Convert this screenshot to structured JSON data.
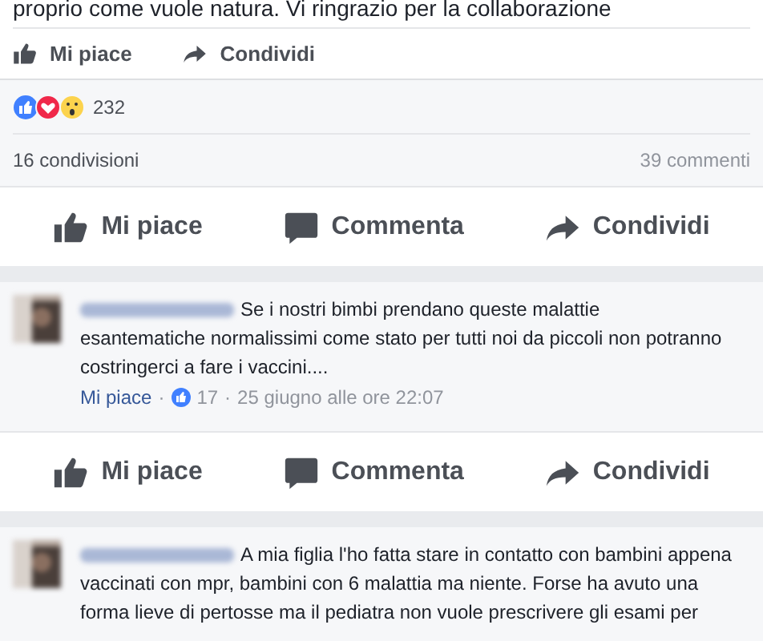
{
  "post": {
    "text_tail": "proprio come vuole natura. Vi ringrazio per la collaborazione",
    "actions": [
      {
        "kind": "like",
        "label": "Mi piace"
      },
      {
        "kind": "share",
        "label": "Condividi"
      }
    ],
    "reactions_count": "232",
    "shares": "16 condivisioni",
    "comments_count": "39 commenti"
  },
  "blocks": [
    {
      "kind": "actionbar",
      "actions": [
        {
          "kind": "like",
          "label": "Mi piace"
        },
        {
          "kind": "comment",
          "label": "Commenta"
        },
        {
          "kind": "share",
          "label": "Condividi"
        }
      ]
    },
    {
      "kind": "comment",
      "lines": [
        "Se i nostri bimbi prendano queste malattie",
        "esantematiche normalissimi come stato per tutti noi da piccoli non potranno",
        "costringerci a fare i vaccini...."
      ],
      "like": "Mi piace",
      "separator": "·",
      "likes": "17",
      "time": "25 giugno alle ore 22:07"
    },
    {
      "kind": "actionbar",
      "actions": [
        {
          "kind": "like",
          "label": "Mi piace"
        },
        {
          "kind": "comment",
          "label": "Commenta"
        },
        {
          "kind": "share",
          "label": "Condividi"
        }
      ]
    },
    {
      "kind": "comment",
      "lines": [
        "A mia figlia l'ho fatta stare in contatto con bambini appena",
        "vaccinati con mpr, bambini con 6 malattia ma niente. Forse ha avuto una",
        "forma lieve di pertosse ma il pediatra non vuole prescrivere gli esami per"
      ]
    }
  ]
}
